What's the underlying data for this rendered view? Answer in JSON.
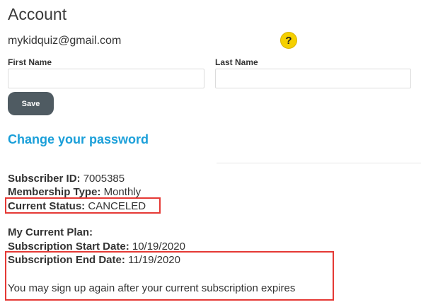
{
  "page": {
    "title": "Account",
    "email": "mykidquiz@gmail.com",
    "help_icon_glyph": "?"
  },
  "form": {
    "first_name_label": "First Name",
    "first_name_value": "",
    "first_name_placeholder": "",
    "last_name_label": "Last Name",
    "last_name_value": "",
    "last_name_placeholder": "",
    "save_label": "Save"
  },
  "password": {
    "link_label": "Change your password"
  },
  "subscription": {
    "subscriber_id_label": "Subscriber ID:",
    "subscriber_id_value": "7005385",
    "membership_type_label": "Membership Type:",
    "membership_type_value": "Monthly",
    "current_status_label": "Current Status:",
    "current_status_value": "CANCELED",
    "current_plan_label": "My Current Plan:",
    "start_date_label": "Subscription Start Date:",
    "start_date_value": "10/19/2020",
    "end_date_label": "Subscription End Date:",
    "end_date_value": "11/19/2020",
    "note": "You may sign up again after your current subscription expires"
  },
  "icons": {
    "help": "help-question-icon"
  },
  "colors": {
    "link": "#1a9fd9",
    "save_button": "#4f5b62",
    "help_icon": "#f5d000",
    "highlight_box": "#e53935"
  }
}
